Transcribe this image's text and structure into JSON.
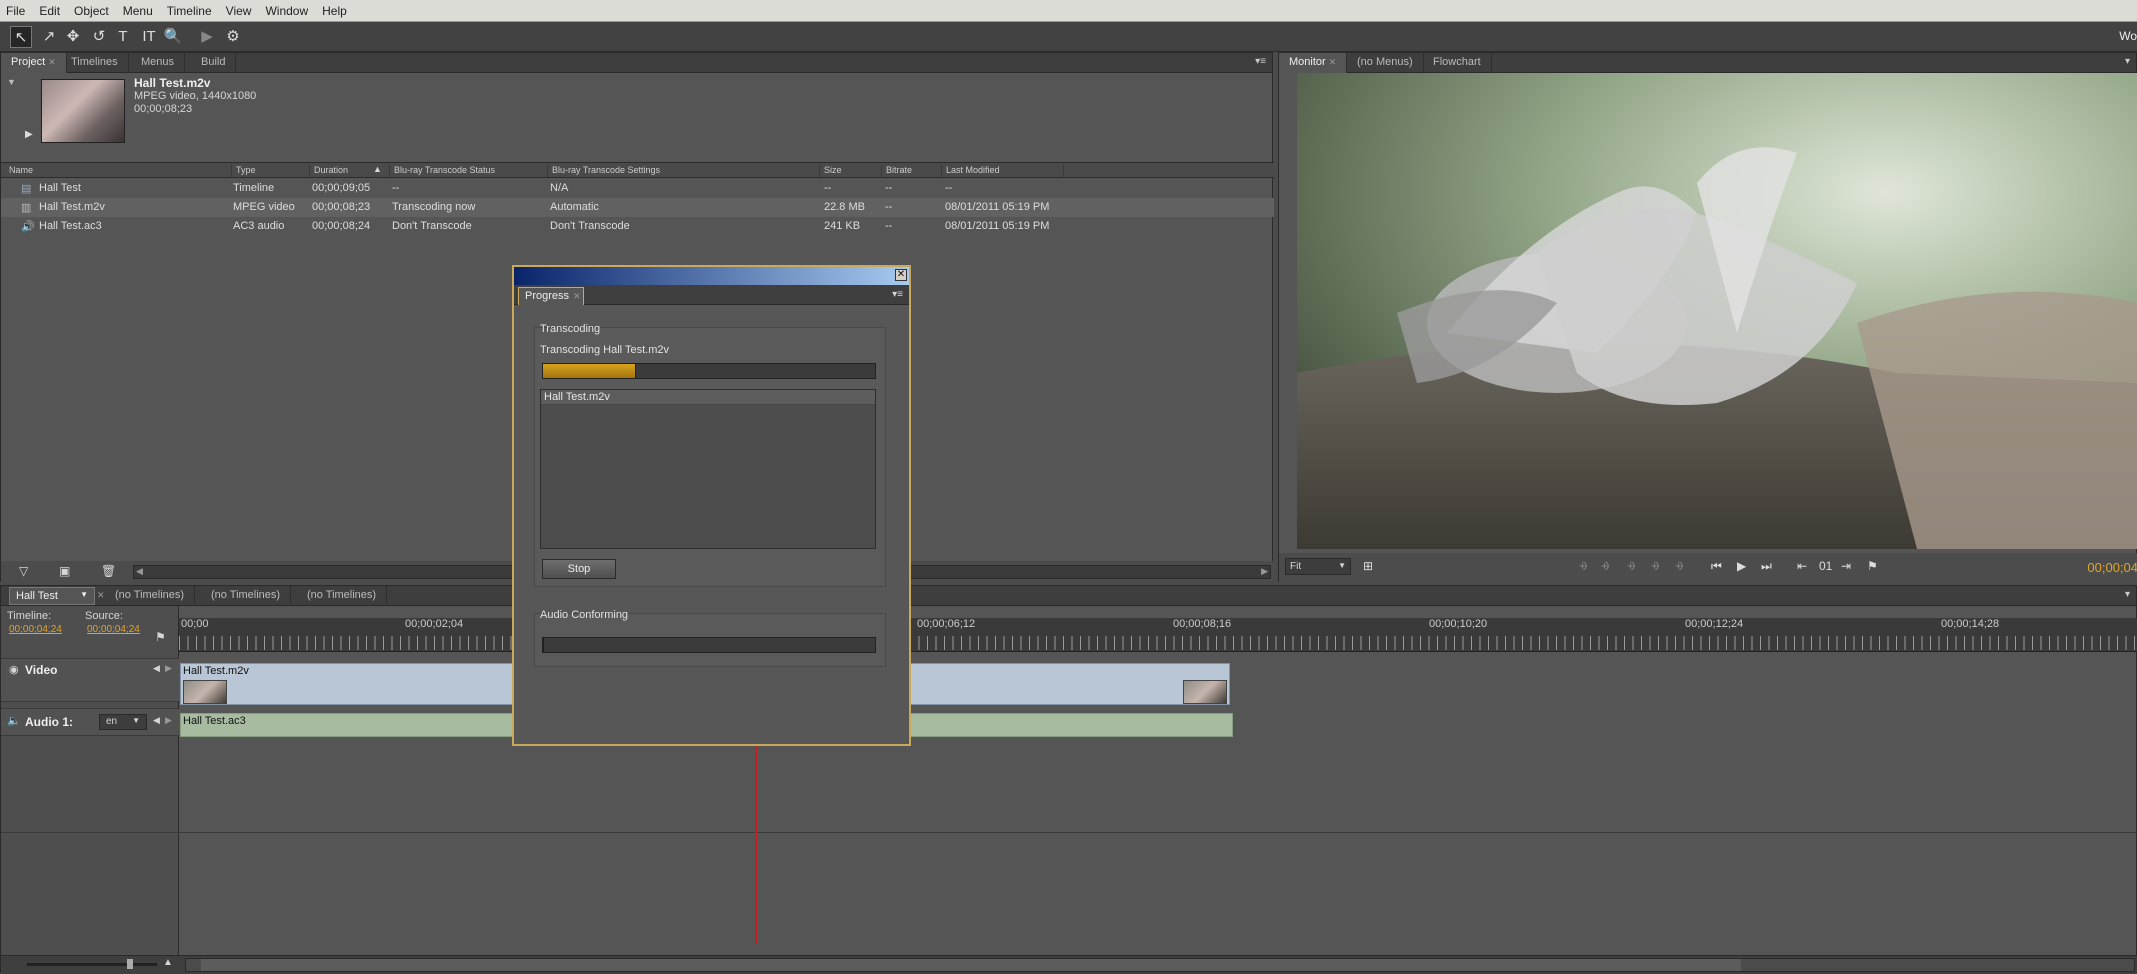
{
  "menu": [
    "File",
    "Edit",
    "Object",
    "Menu",
    "Timeline",
    "View",
    "Window",
    "Help"
  ],
  "toolbar": {
    "right_text": "Wo"
  },
  "project": {
    "tabs": [
      "Project",
      "Timelines",
      "Menus",
      "Build"
    ],
    "clip": {
      "name": "Hall Test.m2v",
      "info": "MPEG video, 1440x1080",
      "duration": "00;00;08;23"
    },
    "columns": [
      "Name",
      "Type",
      "Duration",
      "Blu-ray Transcode Status",
      "Blu-ray Transcode Settings",
      "Size",
      "Bitrate",
      "Last Modified"
    ],
    "rows": [
      {
        "icon": "timeline-icon",
        "name": "Hall Test",
        "type": "Timeline",
        "duration": "00;00;09;05",
        "status": "--",
        "settings": "N/A",
        "size": "--",
        "bitrate": "--",
        "modified": "--"
      },
      {
        "icon": "video-file-icon",
        "name": "Hall Test.m2v",
        "type": "MPEG video",
        "duration": "00;00;08;23",
        "status": "Transcoding now",
        "settings": "Automatic",
        "size": "22.8 MB",
        "bitrate": "--",
        "modified": "08/01/2011 05:19 PM"
      },
      {
        "icon": "audio-file-icon",
        "name": "Hall Test.ac3",
        "type": "AC3 audio",
        "duration": "00;00;08;24",
        "status": "Don't Transcode",
        "settings": "Don't Transcode",
        "size": "241 KB",
        "bitrate": "--",
        "modified": "08/01/2011 05:19 PM"
      }
    ]
  },
  "monitor": {
    "tabs": [
      "Monitor",
      "(no Menus)",
      "Flowchart"
    ],
    "fit": "Fit",
    "angle": "01",
    "timecode": "00;00;04"
  },
  "timeline": {
    "tabs": [
      "Hall Test",
      "(no Timelines)",
      "(no Timelines)",
      "(no Timelines)"
    ],
    "timeline_label": "Timeline:",
    "source_label": "Source:",
    "timeline_tc": "00;00;04;24",
    "source_tc": "00;00;04;24",
    "ruler": [
      "00;00",
      "00;00;02;04",
      "00;00;06;12",
      "00;00;08;16",
      "00;00;10;20",
      "00;00;12;24",
      "00;00;14;28"
    ],
    "video_track": "Video",
    "audio_track": "Audio 1:",
    "audio_lang": "en",
    "video_clip": "Hall Test.m2v",
    "audio_clip": "Hall Test.ac3"
  },
  "dialog": {
    "tab": "Progress",
    "transcoding_label": "Transcoding",
    "transcoding_file": "Transcoding Hall Test.m2v",
    "transcode_progress": 0.28,
    "files": [
      "Hall Test.m2v"
    ],
    "stop": "Stop",
    "audio_label": "Audio Conforming",
    "audio_progress": 0
  },
  "colors": {
    "accent": "#e1a526",
    "progress": "#d8a21d",
    "playhead": "#c42020"
  }
}
